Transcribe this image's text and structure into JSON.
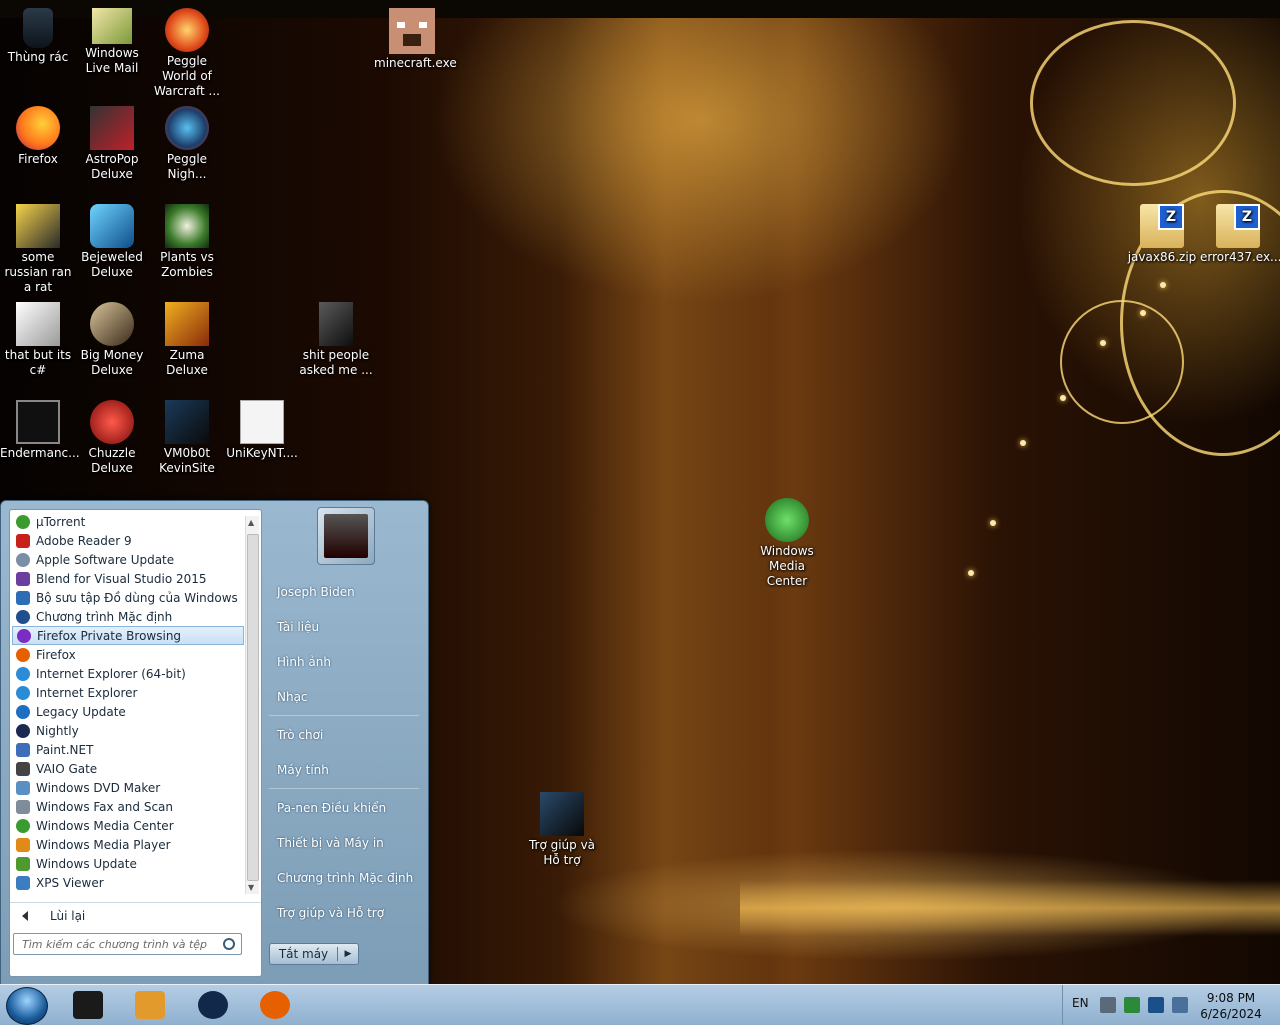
{
  "desktop": {
    "icons": [
      {
        "label": "Thùng rác",
        "icon": "recycle-bin-icon"
      },
      {
        "label": "Windows Live Mail",
        "icon": "mail-icon"
      },
      {
        "label": "Peggle World of Warcraft ...",
        "icon": "game-icon"
      },
      {
        "label": "minecraft.exe",
        "icon": "minecraft-icon"
      },
      {
        "label": "Firefox",
        "icon": "firefox-icon"
      },
      {
        "label": "AstroPop Deluxe",
        "icon": "game-icon"
      },
      {
        "label": "Peggle Nigh...",
        "icon": "game-icon"
      },
      {
        "label": "some russian ran a rat",
        "icon": "shortcut-icon"
      },
      {
        "label": "Bejeweled Deluxe",
        "icon": "game-icon"
      },
      {
        "label": "Plants vs Zombies",
        "icon": "game-icon"
      },
      {
        "label": "javax86.zip",
        "icon": "zip-folder-icon"
      },
      {
        "label": "error437.ex...",
        "icon": "zip-folder-icon"
      },
      {
        "label": "that but its c#",
        "icon": "shortcut-icon"
      },
      {
        "label": "Big Money Deluxe",
        "icon": "game-icon"
      },
      {
        "label": "Zuma Deluxe",
        "icon": "game-icon"
      },
      {
        "label": "shit people asked me ...",
        "icon": "folder-icon"
      },
      {
        "label": "Endermanc...",
        "icon": "terminal-icon"
      },
      {
        "label": "Chuzzle Deluxe",
        "icon": "game-icon"
      },
      {
        "label": "VM0b0t KevinSite",
        "icon": "shortcut-icon"
      },
      {
        "label": "UniKeyNT....",
        "icon": "unikey-icon"
      },
      {
        "label": "Windows Media Center",
        "icon": "media-center-icon"
      },
      {
        "label": "Trợ giúp và Hỗ trợ",
        "icon": "help-icon"
      }
    ]
  },
  "startmenu": {
    "programs": [
      {
        "label": "µTorrent",
        "color": "#3c9b2e"
      },
      {
        "label": "Adobe Reader 9",
        "color": "#c8201b"
      },
      {
        "label": "Apple Software Update",
        "color": "#7a8ea6"
      },
      {
        "label": "Blend for Visual Studio 2015",
        "color": "#6a3fa0"
      },
      {
        "label": "Bộ sưu tập Đồ dùng của Windows",
        "color": "#2d6db5"
      },
      {
        "label": "Chương trình Mặc định",
        "color": "#1f4f8f"
      },
      {
        "label": "Firefox Private Browsing",
        "color": "#7b2cc4"
      },
      {
        "label": "Firefox",
        "color": "#e66000"
      },
      {
        "label": "Internet Explorer (64-bit)",
        "color": "#2a8bd6"
      },
      {
        "label": "Internet Explorer",
        "color": "#2a8bd6"
      },
      {
        "label": "Legacy Update",
        "color": "#1e6fc2"
      },
      {
        "label": "Nightly",
        "color": "#1b2a52"
      },
      {
        "label": "Paint.NET",
        "color": "#3d6fb8"
      },
      {
        "label": "VAIO Gate",
        "color": "#444444"
      },
      {
        "label": "Windows DVD Maker",
        "color": "#5a8fc4"
      },
      {
        "label": "Windows Fax and Scan",
        "color": "#7f8c99"
      },
      {
        "label": "Windows Media Center",
        "color": "#3a9c2e"
      },
      {
        "label": "Windows Media Player",
        "color": "#e08a18"
      },
      {
        "label": "Windows Update",
        "color": "#4f9a2e"
      },
      {
        "label": "XPS Viewer",
        "color": "#3b7dc0"
      }
    ],
    "back_label": "Lùi lại",
    "search_placeholder": "Tìm kiếm các chương trình và tệp",
    "user_name": "Joseph Biden",
    "right_links": [
      "Tài liệu",
      "Hình ảnh",
      "Nhạc",
      "Trò chơi",
      "Máy tính",
      "Pa-nen Điều khiển",
      "Thiết bị và Máy in",
      "Chương trình Mặc định",
      "Trợ giúp và Hỗ trợ"
    ],
    "shutdown_label": "Tắt máy"
  },
  "taskbar": {
    "pinned": [
      {
        "name": "cmd-icon",
        "color": "#1a1a1a"
      },
      {
        "name": "media-player-icon",
        "color": "#e39a2c"
      },
      {
        "name": "globe-icon",
        "color": "#12284a"
      },
      {
        "name": "firefox-icon",
        "color": "#e66000"
      }
    ],
    "language": "EN",
    "time": "9:08 PM",
    "date": "6/26/2024"
  }
}
